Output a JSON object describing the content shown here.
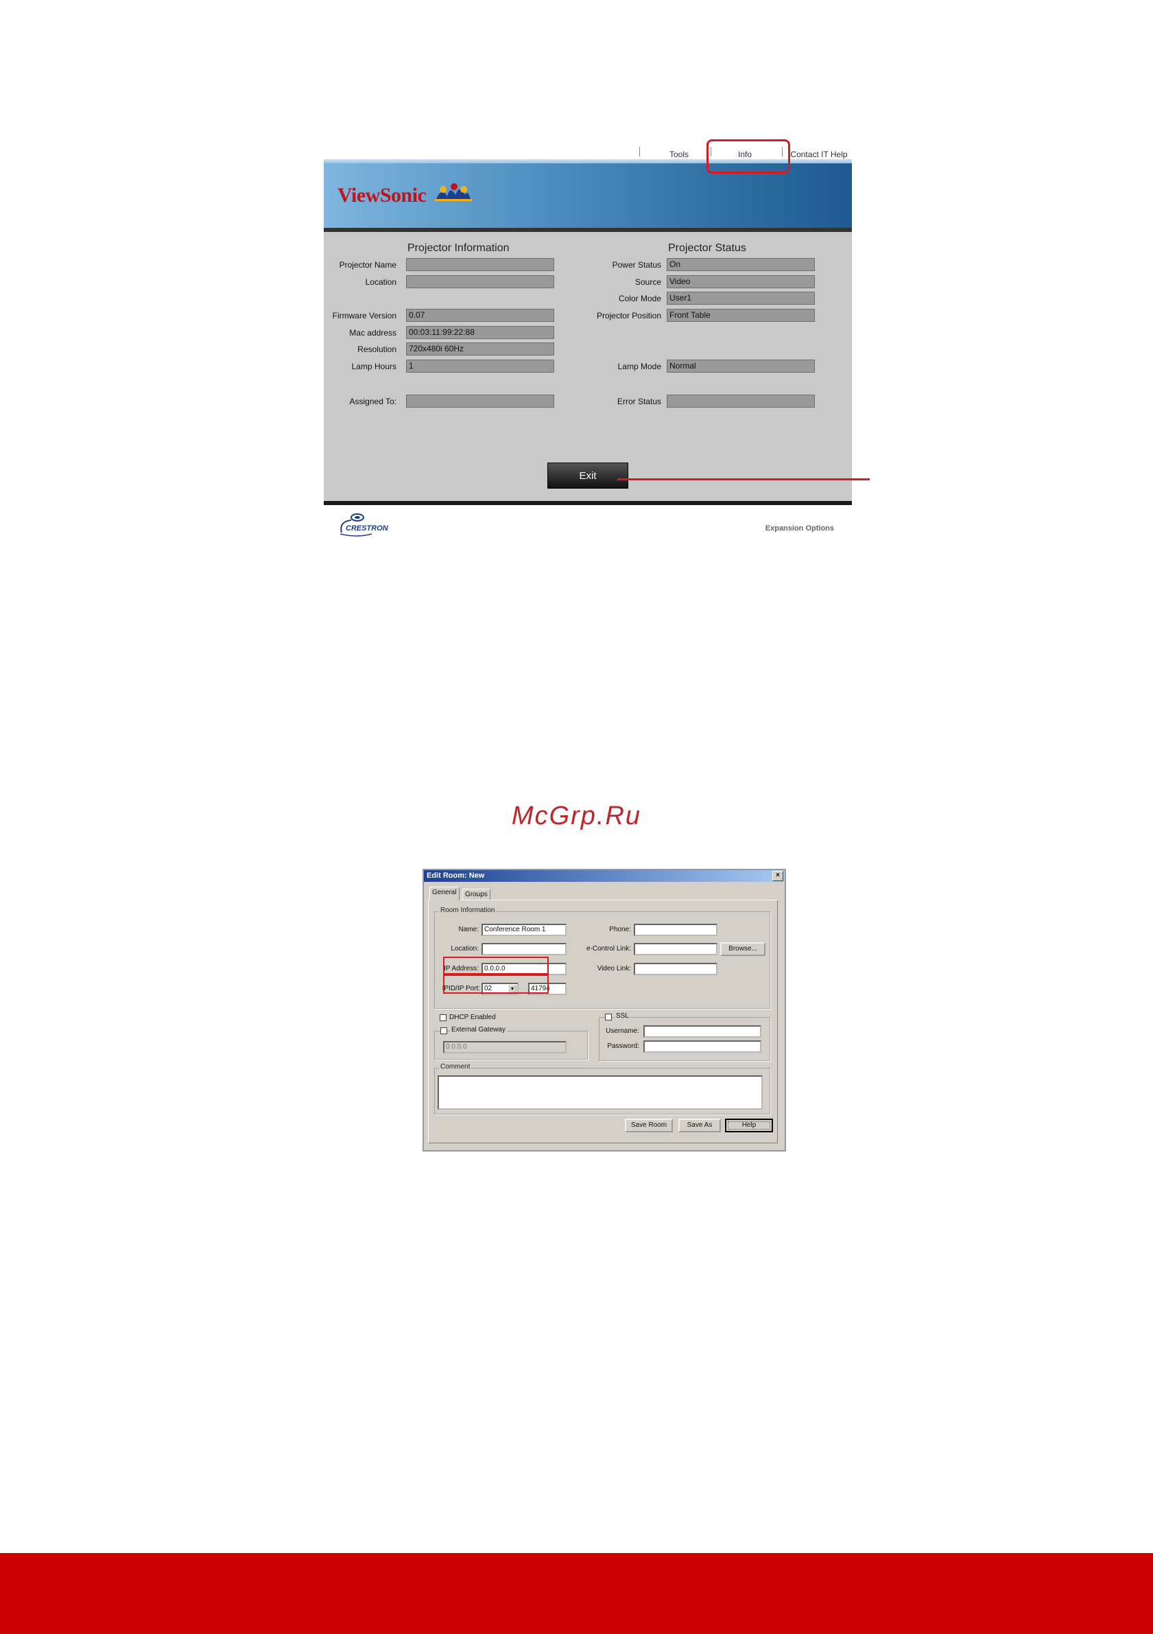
{
  "projector_ui": {
    "nav": {
      "tools": "Tools",
      "info": "Info",
      "contact": "Contact IT Help"
    },
    "brand": "ViewSonic",
    "info_section": {
      "title": "Projector Information",
      "fields": [
        {
          "label": "Projector Name",
          "value": ""
        },
        {
          "label": "Location",
          "value": ""
        },
        {
          "label": "Firmware Version",
          "value": "0.07"
        },
        {
          "label": "Mac address",
          "value": "00:03:11:99:22:88"
        },
        {
          "label": "Resolution",
          "value": "720x480i 60Hz"
        },
        {
          "label": "Lamp Hours",
          "value": "1"
        },
        {
          "label": "Assigned To:",
          "value": ""
        }
      ]
    },
    "status_section": {
      "title": "Projector Status",
      "fields": [
        {
          "label": "Power Status",
          "value": "On"
        },
        {
          "label": "Source",
          "value": "Video"
        },
        {
          "label": "Color Mode",
          "value": "User1"
        },
        {
          "label": "Projector Position",
          "value": "Front Table"
        },
        {
          "label": "Lamp Mode",
          "value": "Normal"
        },
        {
          "label": "Error Status",
          "value": ""
        }
      ]
    },
    "exit_label": "Exit",
    "crestron": "CRESTRON",
    "expansion": "Expansion Options"
  },
  "watermark": "McGrp.Ru",
  "dialog": {
    "title": "Edit Room: New",
    "close": "×",
    "tabs": [
      "General",
      "Groups"
    ],
    "room_group": "Room Information",
    "name_label": "Name:",
    "name_value": "Conference Room 1",
    "location_label": "Location:",
    "location_value": "",
    "ip_label": "IP Address:",
    "ip_value": "0.0.0.0",
    "ipid_label": "IPID/IP Port:",
    "ipid_value": "02",
    "port_value": "41794",
    "phone_label": "Phone:",
    "econtrol_label": "e-Control Link:",
    "video_label": "Video Link:",
    "browse_label": "Browse...",
    "dhcp_label": "DHCP Enabled",
    "gateway_label": "External Gateway",
    "gateway_value": "0.0.0.0",
    "ssl_label": "SSL",
    "username_label": "Username:",
    "password_label": "Password:",
    "comment_label": "Comment",
    "save_room": "Save Room",
    "save_as": "Save As",
    "help": "Help"
  },
  "colors": {
    "accent_red": "#d71920",
    "footer_red": "#cc0000",
    "banner_blue": "#4a8abd",
    "brand_red": "#c4121b"
  }
}
